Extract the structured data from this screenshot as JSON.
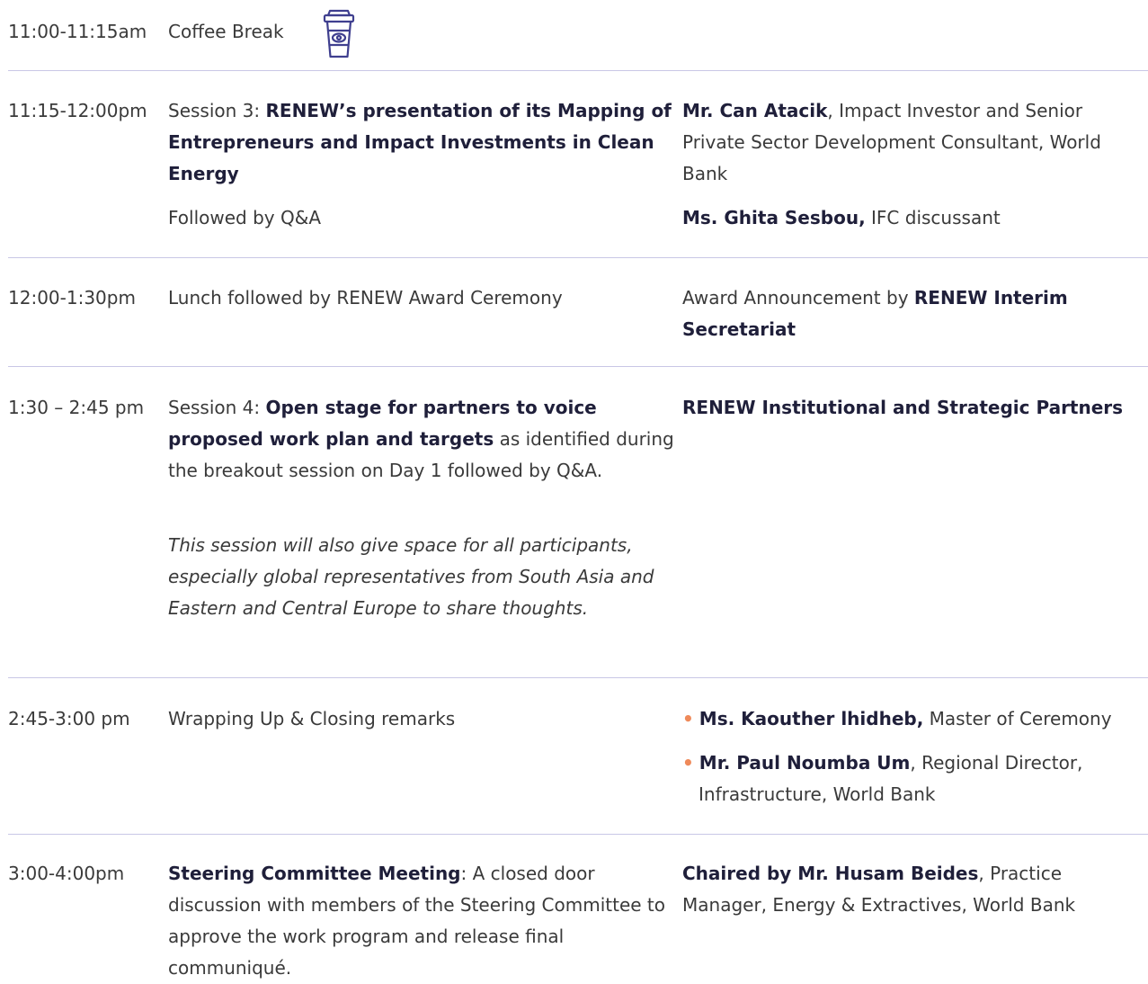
{
  "row1": {
    "time": "11:00-11:15am",
    "activity": "Coffee Break",
    "icon": "coffee-cup-icon",
    "icon_color": "#3f3f8f"
  },
  "row2": {
    "time": "11:15-12:00pm",
    "session_prefix": "Session 3: ",
    "session_title": "RENEW’s presentation of its Mapping of Entrepreneurs and Impact Investments in Clean Energy",
    "followup": "Followed by Q&A",
    "speaker1_name": "Mr. Can Atacik",
    "speaker1_role": ", Impact Investor and Senior Private Sector Development Consultant, World Bank",
    "speaker2_name": "Ms. Ghita Sesbou,",
    "speaker2_role": " IFC discussant"
  },
  "row3": {
    "time": "12:00-1:30pm",
    "activity": "Lunch followed by RENEW Award Ceremony",
    "right_prefix": "Award Announcement by ",
    "right_bold": "RENEW Interim Secretariat"
  },
  "row4": {
    "time": "1:30 – 2:45 pm",
    "session_prefix": "Session 4: ",
    "session_bold": "Open stage for partners to voice proposed work plan and targets",
    "session_rest": " as identified during the breakout session on Day 1 followed by Q&A.",
    "note": "This session will also give space for all participants, especially global representatives from South Asia and Eastern and Central Europe to share thoughts.",
    "right_bold": "RENEW Institutional and Strategic Partners"
  },
  "row5": {
    "time": "2:45-3:00 pm",
    "activity": "Wrapping Up & Closing remarks",
    "bullet": "•",
    "speaker1_name": "Ms. Kaouther lhidheb,",
    "speaker1_role": " Master of Ceremony",
    "speaker2_name": "Mr. Paul Noumba Um",
    "speaker2_role": ", Regional Director, Infrastructure, World Bank"
  },
  "row6": {
    "time": "3:00-4:00pm",
    "session_bold": "Steering Committee Meeting",
    "session_rest": ": A closed door discussion with members of the Steering Committee to approve the work program and release final communiqué.",
    "right_bold": "Chaired by Mr. Husam Beides",
    "right_rest": ", Practice Manager, Energy & Extractives, World Bank"
  },
  "colors": {
    "separator": "#c9c7e6",
    "bullet": "#ef8a5a",
    "text": "#3a3a3a",
    "bold_text": "#1f1f3a"
  }
}
